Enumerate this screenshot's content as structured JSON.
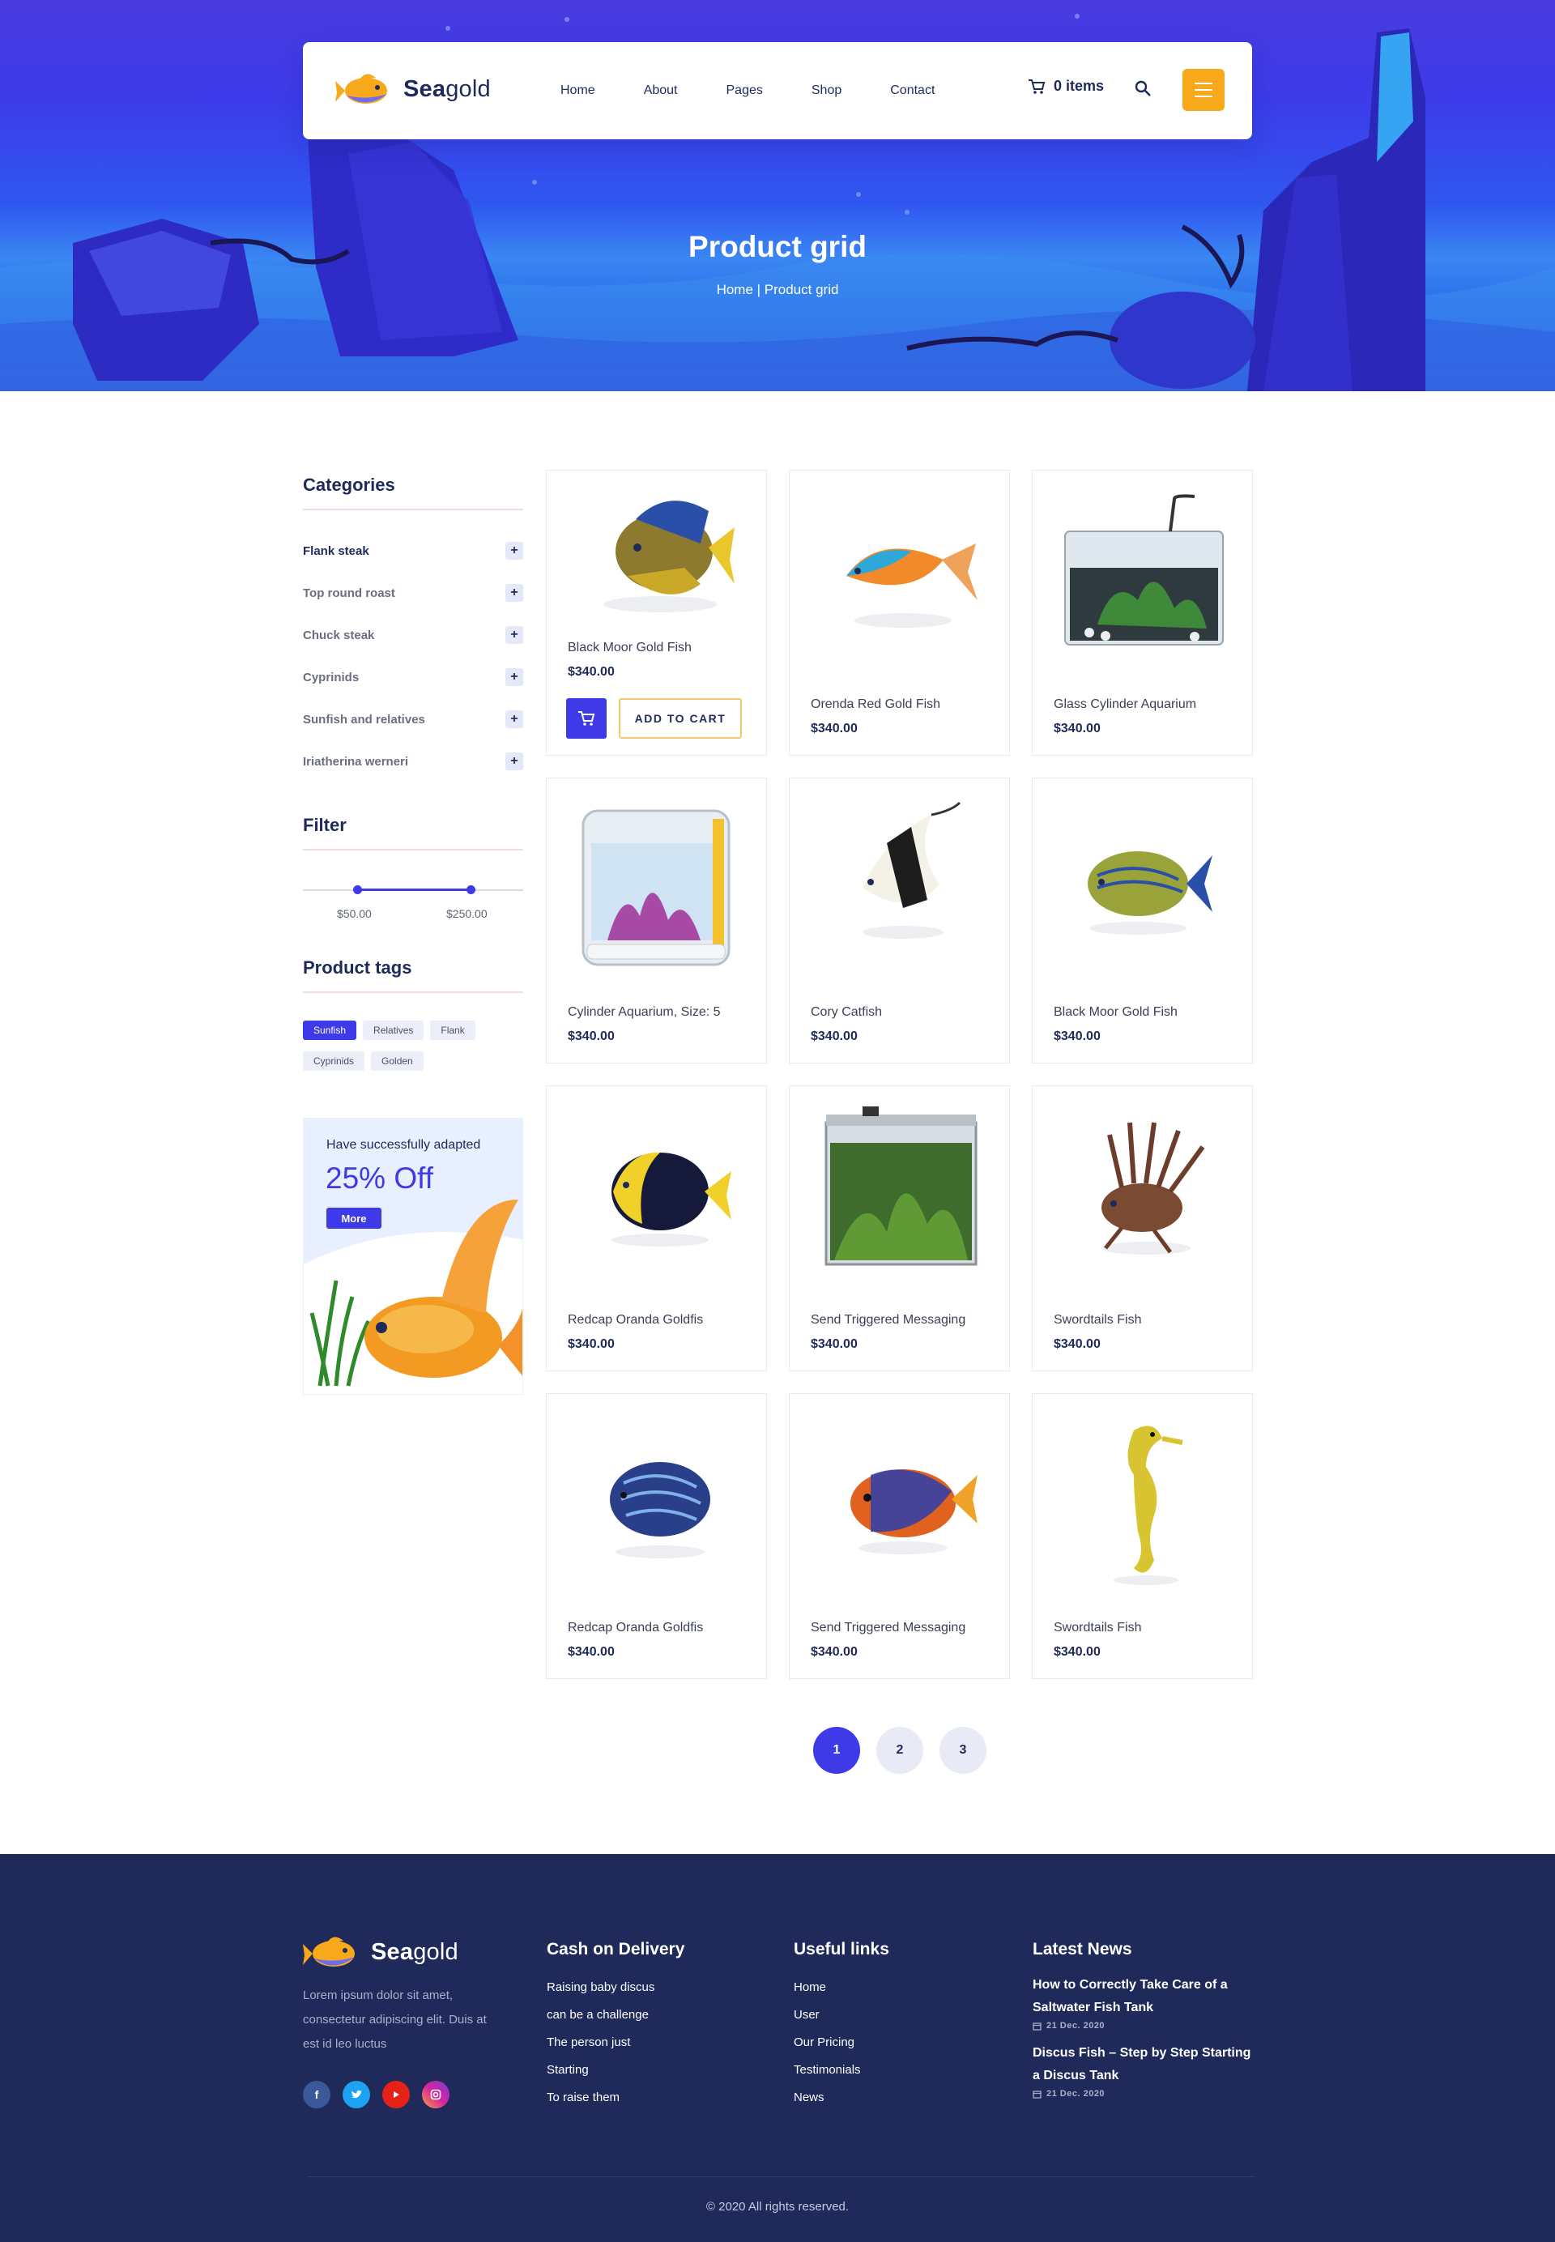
{
  "header": {
    "logo_bold": "Sea",
    "logo_rest": "gold",
    "nav": [
      "Home",
      "About",
      "Pages",
      "Shop",
      "Contact"
    ],
    "cart_label": "0 items",
    "search_icon": "search-icon",
    "menu_icon": "hamburger-icon"
  },
  "hero": {
    "title": "Product grid",
    "breadcrumb": "Home | Product grid"
  },
  "sidebar": {
    "categories_title": "Categories",
    "categories": [
      "Flank steak",
      "Top round roast",
      "Chuck steak",
      "Cyprinids",
      "Sunfish and relatives",
      "Iriatherina werneri"
    ],
    "filter_title": "Filter",
    "price_min": "$50.00",
    "price_max": "$250.00",
    "tags_title": "Product tags",
    "tags": [
      "Sunfish",
      "Relatives",
      "Flank",
      "Cyprinids",
      "Golden"
    ],
    "promo": {
      "subtitle": "Have successfully adapted",
      "headline": "25% Off",
      "button": "More"
    }
  },
  "products": [
    {
      "name": "Black Moor Gold Fish",
      "price": "$340.00"
    },
    {
      "name": "Orenda Red Gold Fish",
      "price": "$340.00"
    },
    {
      "name": "Glass Cylinder Aquarium",
      "price": "$340.00"
    },
    {
      "name": "Cylinder Aquarium, Size: 5",
      "price": "$340.00"
    },
    {
      "name": "Cory Catfish",
      "price": "$340.00"
    },
    {
      "name": "Black Moor Gold Fish",
      "price": "$340.00"
    },
    {
      "name": "Redcap Oranda Goldfis",
      "price": "$340.00"
    },
    {
      "name": "Send Triggered Messaging",
      "price": "$340.00"
    },
    {
      "name": "Swordtails Fish",
      "price": "$340.00"
    },
    {
      "name": "Redcap Oranda Goldfis",
      "price": "$340.00"
    },
    {
      "name": "Send Triggered Messaging",
      "price": "$340.00"
    },
    {
      "name": "Swordtails Fish",
      "price": "$340.00"
    }
  ],
  "add_to_cart": "ADD TO CART",
  "pagination": [
    "1",
    "2",
    "3"
  ],
  "footer": {
    "about": "Lorem ipsum dolor sit amet, consectetur adipiscing elit. Duis at est id leo luctus",
    "socials": [
      "facebook-icon",
      "twitter-icon",
      "youtube-icon",
      "instagram-icon"
    ],
    "col1_title": "Cash on Delivery",
    "col1_items": [
      "Raising baby discus",
      "can be a challenge",
      "The person just",
      "Starting",
      "To raise them"
    ],
    "col2_title": "Useful links",
    "col2_items": [
      "Home",
      "User",
      "Our Pricing",
      "Testimonials",
      "News"
    ],
    "col3_title": "Latest News",
    "news": [
      {
        "title": "How to Correctly Take Care of a Saltwater Fish Tank",
        "date": "21 Dec. 2020"
      },
      {
        "title": "Discus Fish – Step by Step Starting a Discus Tank",
        "date": "21 Dec. 2020"
      }
    ],
    "copyright": "© 2020 All rights reserved."
  },
  "colors": {
    "primary": "#3e3ae7",
    "accent": "#f8a91b",
    "dark": "#1e2a5a",
    "footer_bg": "#1f2a5a"
  }
}
